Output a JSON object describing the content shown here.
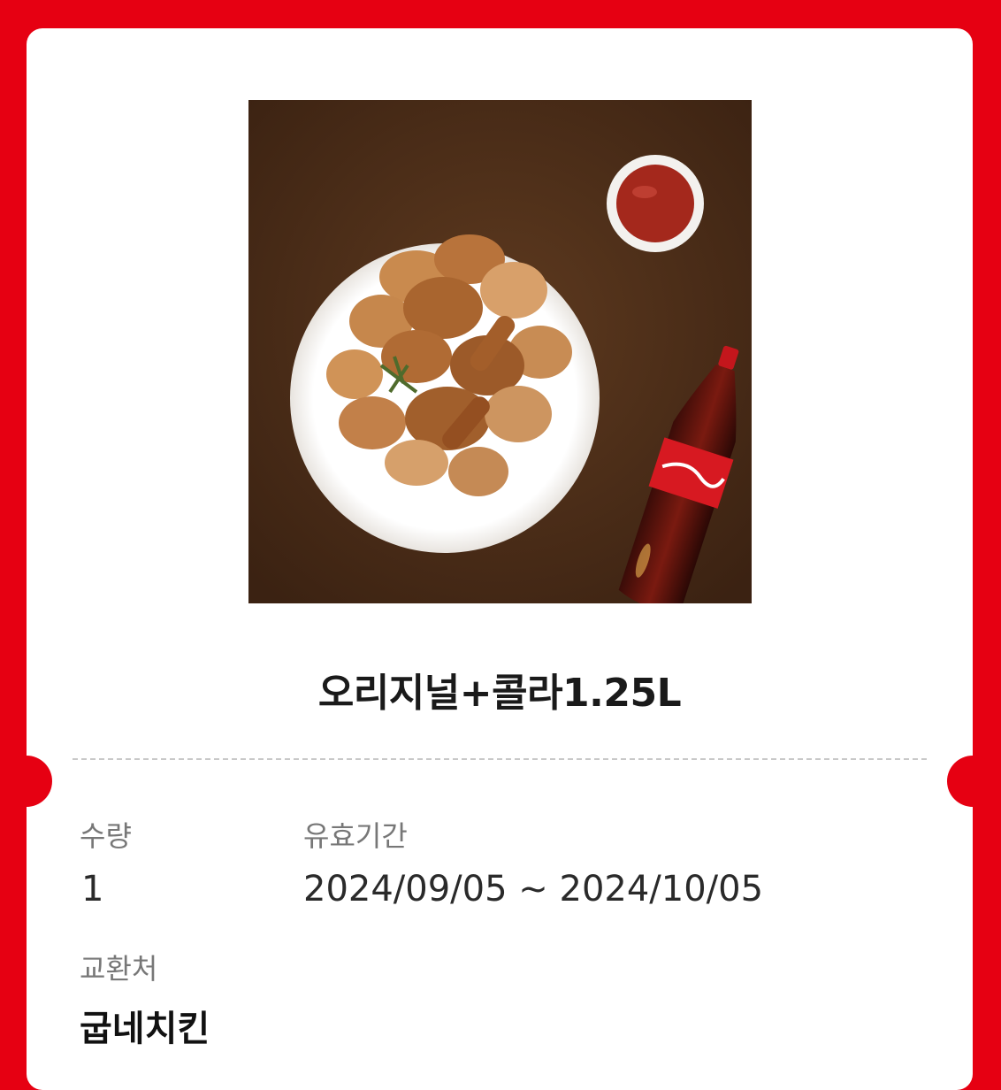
{
  "product": {
    "name": "오리지널+콜라1.25L",
    "image_icon": "chicken-and-cola-image"
  },
  "details": {
    "quantity_label": "수량",
    "quantity_value": "1",
    "validity_label": "유효기간",
    "validity_value": "2024/09/05 ~ 2024/10/05",
    "store_label": "교환처",
    "store_value": "굽네치킨"
  },
  "colors": {
    "frame_red": "#e60012",
    "card_white": "#ffffff",
    "image_background": "#4a2c17"
  }
}
